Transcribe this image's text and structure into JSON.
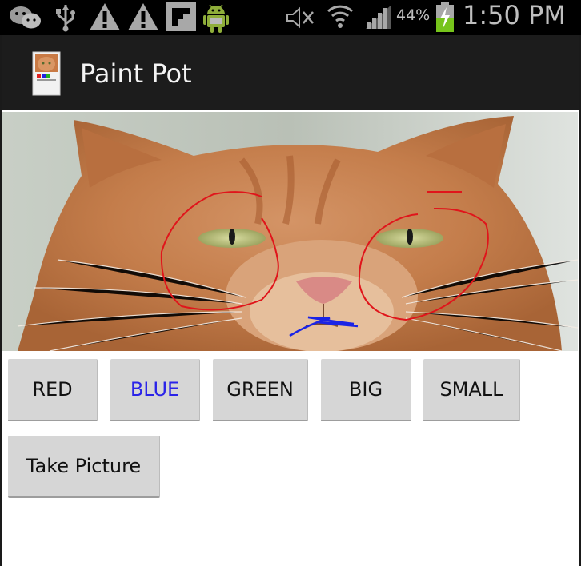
{
  "status_bar": {
    "battery_percent": "44%",
    "time": "1:50 PM",
    "icons": [
      "wechat-icon",
      "usb-icon",
      "warning-icon",
      "warning-icon",
      "flipboard-icon",
      "android-debug-icon",
      "mute-icon",
      "wifi-icon",
      "signal-icon",
      "battery-charging-icon"
    ]
  },
  "action_bar": {
    "title": "Paint Pot",
    "background": "#1c1c1c"
  },
  "canvas": {
    "content": "cat-photo",
    "stroke_colors": [
      "#e0151b",
      "#1a23e6"
    ]
  },
  "buttons": {
    "red": "RED",
    "blue": "BLUE",
    "green": "GREEN",
    "big": "BIG",
    "small": "SMALL",
    "take_picture": "Take Picture"
  },
  "colors": {
    "selected_button_text": "#2a23e8",
    "button_bg": "#d6d6d6"
  }
}
